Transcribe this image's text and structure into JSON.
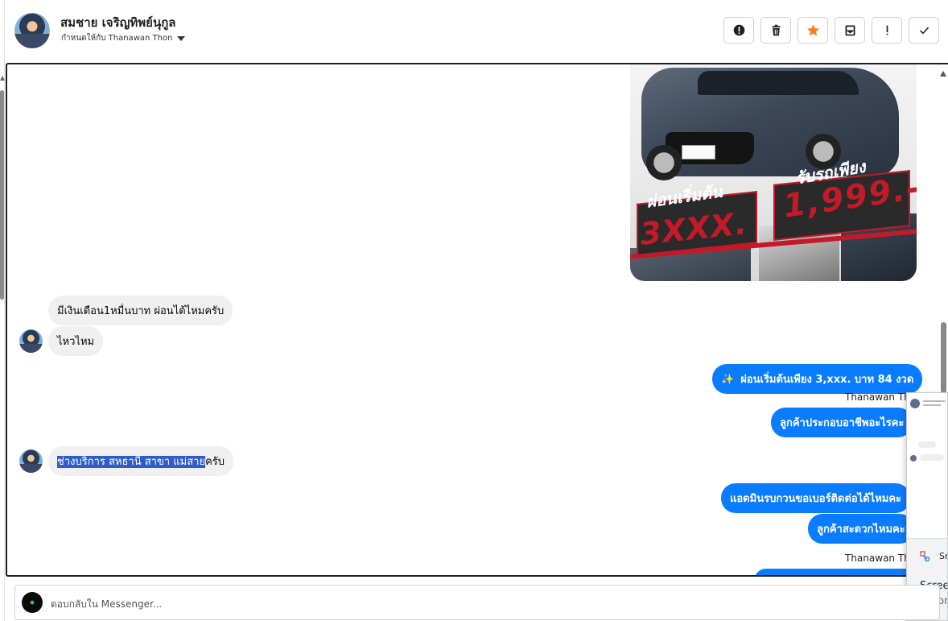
{
  "header": {
    "contact_name": "สมชาย เจริญทิพย์นุกูล",
    "assigned_to": "กำหนดให้กับ Thanawan Thon",
    "actions": [
      {
        "name": "report-spam-icon"
      },
      {
        "name": "delete-icon"
      },
      {
        "name": "star-icon"
      },
      {
        "name": "mark-unread-icon"
      },
      {
        "name": "important-icon"
      },
      {
        "name": "check-icon"
      }
    ]
  },
  "promo_image": {
    "left_caption": "ผ่อนเริ่มต้น",
    "left_price": "3XXX.",
    "right_caption": "รับรถเพียง",
    "right_price": "1,999.-"
  },
  "messages": [
    {
      "side": "in",
      "text": "มีเงินเดือน1หมื่นบาท ผ่อนได้ไหมครับ"
    },
    {
      "side": "in",
      "text": "ไหวไหม"
    },
    {
      "side": "out",
      "text": "ผ่อนเริ่มต้นเพียง 3,xxx. บาท 84 งวด",
      "sparkle": "✨"
    },
    {
      "side": "out",
      "sender": "Thanawan Thon",
      "text": "ลูกค้าประกอบอาชีพอะไรคะ"
    },
    {
      "side": "in",
      "selected": "ช่างบริการ สหธานี สาขา แม่สาย",
      "text": "ครับ"
    },
    {
      "side": "out",
      "text": "แอดมินรบกวนขอเบอร์ติดต่อได้ไหมคะ"
    },
    {
      "side": "out",
      "text": "ลูกค้าสะดวกไหมคะ"
    },
    {
      "side": "out",
      "sender": "Thanawan Thon"
    }
  ],
  "overlay": {
    "snip_label": "Sn",
    "line1": "Screen",
    "line2": "Autom"
  },
  "reply": {
    "placeholder": "ตอบกลับใน Messenger..."
  },
  "colors": {
    "outgoing_bubble": "#0a7cff",
    "incoming_bubble": "#f0f0f0",
    "star": "#f5821f",
    "promo_red": "#c21a26",
    "selection": "#2f5dc8"
  }
}
